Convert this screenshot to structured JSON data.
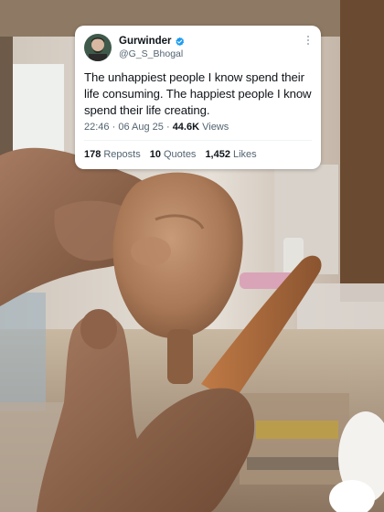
{
  "tweet": {
    "display_name": "Gurwinder",
    "handle": "@G_S_Bhogal",
    "text": "The unhappiest people I know spend their life consuming. The happiest people I know spend their life creating.",
    "time": "22:46",
    "date": "06 Aug 25",
    "separator": "·",
    "views_count": "44.6K",
    "views_label": "Views",
    "reposts_count": "178",
    "reposts_label": "Reposts",
    "quotes_count": "10",
    "quotes_label": "Quotes",
    "likes_count": "1,452",
    "likes_label": "Likes"
  },
  "colors": {
    "verified": "#1d9bf0",
    "text_primary": "#0f1419",
    "text_secondary": "#536471"
  },
  "icons": [
    "verified-badge-icon",
    "more-options-icon"
  ]
}
